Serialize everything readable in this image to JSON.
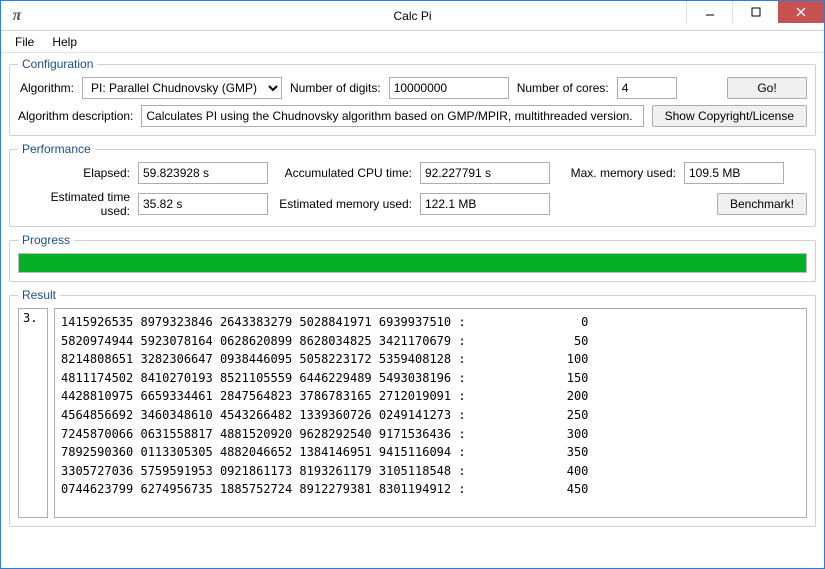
{
  "window": {
    "title": "Calc Pi",
    "icon_glyph": "π"
  },
  "menu": {
    "file": "File",
    "help": "Help"
  },
  "config": {
    "legend": "Configuration",
    "algo_label": "Algorithm:",
    "algo_selected": "PI: Parallel Chudnovsky (GMP)",
    "digits_label": "Number of digits:",
    "digits_value": "10000000",
    "cores_label": "Number of cores:",
    "cores_value": "4",
    "go_label": "Go!",
    "desc_label": "Algorithm description:",
    "desc_value": "Calculates PI using the Chudnovsky algorithm based on GMP/MPIR, multithreaded version.",
    "copyright_label": "Show Copyright/License"
  },
  "perf": {
    "legend": "Performance",
    "elapsed_label": "Elapsed:",
    "elapsed_value": "59.823928 s",
    "cpu_label": "Accumulated CPU time:",
    "cpu_value": "92.227791 s",
    "mem_label": "Max. memory used:",
    "mem_value": "109.5 MB",
    "est_time_label": "Estimated time used:",
    "est_time_value": "35.82 s",
    "est_mem_label": "Estimated memory used:",
    "est_mem_value": "122.1 MB",
    "bench_label": "Benchmark!"
  },
  "progress": {
    "legend": "Progress",
    "percent": 100
  },
  "result": {
    "legend": "Result",
    "prefix": "3.",
    "lines": [
      "1415926535 8979323846 2643383279 5028841971 6939937510 :                0",
      "5820974944 5923078164 0628620899 8628034825 3421170679 :               50",
      "8214808651 3282306647 0938446095 5058223172 5359408128 :              100",
      "4811174502 8410270193 8521105559 6446229489 5493038196 :              150",
      "4428810975 6659334461 2847564823 3786783165 2712019091 :              200",
      "4564856692 3460348610 4543266482 1339360726 0249141273 :              250",
      "7245870066 0631558817 4881520920 9628292540 9171536436 :              300",
      "7892590360 0113305305 4882046652 1384146951 9415116094 :              350",
      "3305727036 5759591953 0921861173 8193261179 3105118548 :              400",
      "0744623799 6274956735 1885752724 8912279381 8301194912 :              450"
    ]
  }
}
